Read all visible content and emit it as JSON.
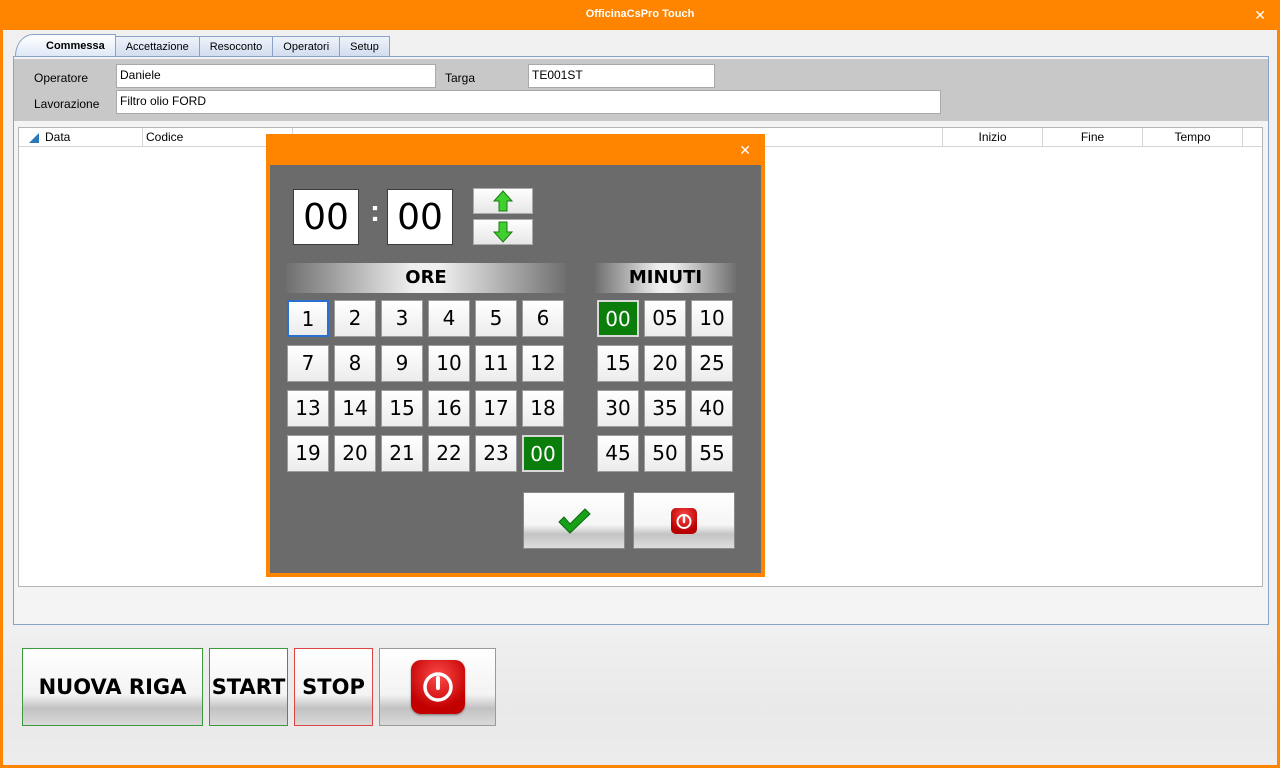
{
  "window": {
    "title": "OfficinaCsPro Touch",
    "close_glyph": "✕"
  },
  "tabs": [
    {
      "label": "Commessa",
      "active": true
    },
    {
      "label": "Accettazione"
    },
    {
      "label": "Resoconto"
    },
    {
      "label": "Operatori"
    },
    {
      "label": "Setup"
    }
  ],
  "form": {
    "operatore_label": "Operatore",
    "operatore_value": "Daniele",
    "targa_label": "Targa",
    "targa_value": "TE001ST",
    "lavorazione_label": "Lavorazione",
    "lavorazione_value": "Filtro olio FORD"
  },
  "grid": {
    "columns": [
      "Data",
      "Codice",
      "",
      "Inizio",
      "Fine",
      "Tempo"
    ]
  },
  "buttons": {
    "nuova_riga": "NUOVA RIGA",
    "start": "START",
    "stop": "STOP",
    "power_icon": "power-icon"
  },
  "time_picker": {
    "close_glyph": "✕",
    "hours_value": "00",
    "minutes_value": "00",
    "colon": ":",
    "ore_label": "ORE",
    "minuti_label": "MINUTI",
    "hours": [
      "1",
      "2",
      "3",
      "4",
      "5",
      "6",
      "7",
      "8",
      "9",
      "10",
      "11",
      "12",
      "13",
      "14",
      "15",
      "16",
      "17",
      "18",
      "19",
      "20",
      "21",
      "22",
      "23",
      "00"
    ],
    "minutes": [
      "00",
      "05",
      "10",
      "15",
      "20",
      "25",
      "30",
      "35",
      "40",
      "45",
      "50",
      "55"
    ],
    "selected_hour": "00",
    "selected_minute": "00",
    "focused_hour": "1",
    "colors": {
      "accent": "#ff8400",
      "selected": "#0a7d0a",
      "panel": "#6b6b6b"
    }
  }
}
